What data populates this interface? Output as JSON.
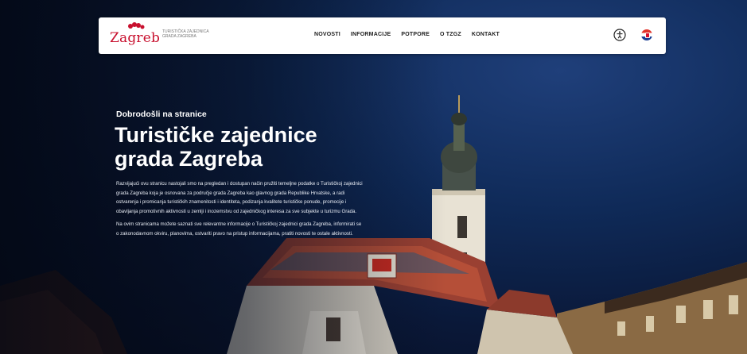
{
  "header": {
    "logo_text": "Zagreb",
    "org_line1": "TURISTIČKA ZAJEDNICA",
    "org_line2": "GRADA ZAGREBA",
    "nav": [
      "NOVOSTI",
      "INFORMACIJE",
      "POTPORE",
      "O TZGZ",
      "KONTAKT"
    ]
  },
  "hero": {
    "subtitle": "Dobrodošli na stranice",
    "title_line1": "Turističke zajednice",
    "title_line2": "grada Zagreba",
    "paragraph1": "Razvijajući ovu stranicu nastojali smo na pregledan i dostupan način pružiti temeljne podatke o Turističkoj zajednici grada Zagreba koja je osnovana za područje grada Zagreba kao glavnog grada Republike Hrvatske, a radi ostvarenja i promicanja turističkih znamenitosti i identiteta, podizanja kvalitete turističke ponude, promocije i obavljanja promotivnih aktivnosti u zemlji i inozemstvu od zajedničkog interesa za sve subjekte u turizmu Grada.",
    "paragraph2": "Na ovim stranicama možete saznati sve relevantne informacije o Turističkoj zajednici grada Zagreba, informirati se o zakonodavnom okviru, planovima, ostvariti pravo na pristup informacijama, pratiti novosti te ostale aktivnosti."
  },
  "colors": {
    "brand_red": "#c8102e",
    "sky_dark": "#0a1838",
    "sky_light": "#1f3f7a"
  },
  "icons": {
    "accessibility": "accessibility-icon",
    "language": "croatian-flag-icon"
  }
}
